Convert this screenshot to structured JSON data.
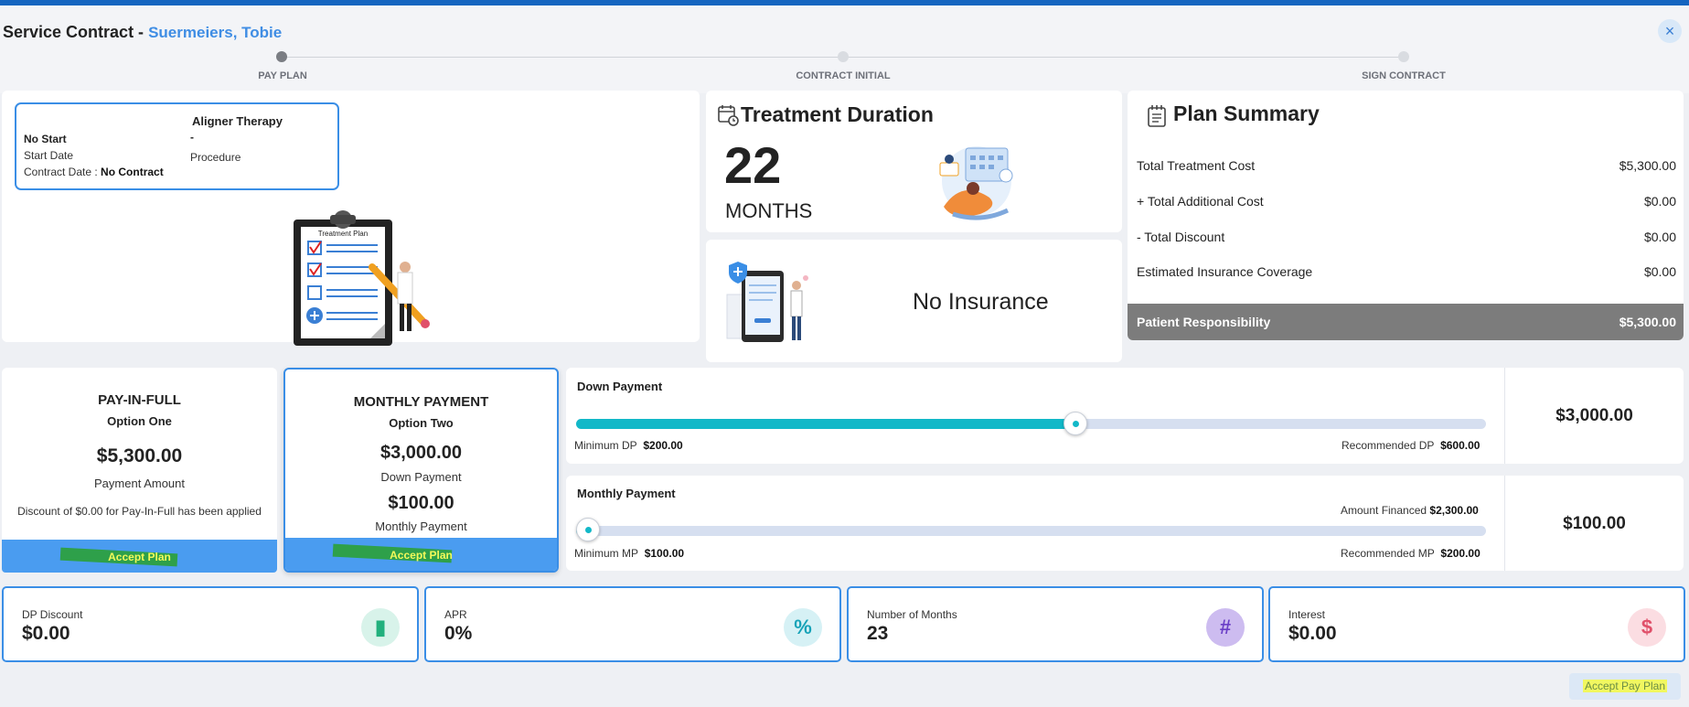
{
  "header": {
    "title": "Service Contract -",
    "patient_name": "Suermeiers, Tobie",
    "close_icon": "×"
  },
  "steps": [
    {
      "label": "PAY PLAN",
      "active": true
    },
    {
      "label": "CONTRACT INITIAL",
      "active": false
    },
    {
      "label": "SIGN CONTRACT",
      "active": false
    }
  ],
  "procedure": {
    "title": "Aligner Therapy",
    "start_label": "No Start",
    "start_value": "-",
    "start_date_label": "Start Date",
    "procedure_label": "Procedure",
    "contract_date_label": "Contract Date :",
    "contract_date_value": "No Contract",
    "illustration_caption": "Treatment Plan"
  },
  "treatment_duration": {
    "title": "Treatment Duration",
    "value": "22",
    "unit": "MONTHS"
  },
  "insurance": {
    "text": "No Insurance"
  },
  "plan_summary": {
    "title": "Plan Summary",
    "rows": [
      {
        "label": "Total Treatment Cost",
        "value": "$5,300.00"
      },
      {
        "label": "+ Total Additional Cost",
        "value": "$0.00"
      },
      {
        "label": "- Total Discount",
        "value": "$0.00"
      },
      {
        "label": "Estimated Insurance Coverage",
        "value": "$0.00"
      }
    ],
    "responsibility_label": "Patient Responsibility",
    "responsibility_value": "$5,300.00"
  },
  "options": {
    "pay_in_full": {
      "title": "PAY-IN-FULL",
      "subtitle": "Option One",
      "amount": "$5,300.00",
      "amount_label": "Payment Amount",
      "note": "Discount of $0.00 for Pay-In-Full has been applied",
      "button": "Accept Plan"
    },
    "monthly": {
      "title": "MONTHLY PAYMENT",
      "subtitle": "Option Two",
      "down_amount": "$3,000.00",
      "down_label": "Down Payment",
      "monthly_amount": "$100.00",
      "monthly_label": "Monthly Payment",
      "button": "Accept Plan"
    }
  },
  "down_payment": {
    "title": "Down Payment",
    "min_label": "Minimum DP",
    "min_value": "$200.00",
    "rec_label": "Recommended DP",
    "rec_value": "$600.00",
    "value": "$3,000.00",
    "slider_fraction": 0.55
  },
  "monthly_payment": {
    "title": "Monthly Payment",
    "financed_label": "Amount Financed",
    "financed_value": "$2,300.00",
    "min_label": "Minimum MP",
    "min_value": "$100.00",
    "rec_label": "Recommended MP",
    "rec_value": "$200.00",
    "value": "$100.00",
    "slider_fraction": 0.0
  },
  "stats": [
    {
      "label": "DP Discount",
      "value": "$0.00",
      "icon": "battery-icon",
      "glyph": "▮",
      "color": "#22b07d",
      "bg": "#d8f3ea"
    },
    {
      "label": "APR",
      "value": "0%",
      "icon": "percent-icon",
      "glyph": "%",
      "color": "#17a3b8",
      "bg": "#d6f1f5"
    },
    {
      "label": "Number of Months",
      "value": "23",
      "icon": "hash-icon",
      "glyph": "#",
      "color": "#6a3fc7",
      "bg": "#cdbcf0"
    },
    {
      "label": "Interest",
      "value": "$0.00",
      "icon": "dollar-icon",
      "glyph": "$",
      "color": "#e0506a",
      "bg": "#fbdde2"
    }
  ],
  "footer": {
    "accept_pay_plan": "Accept Pay Plan"
  }
}
